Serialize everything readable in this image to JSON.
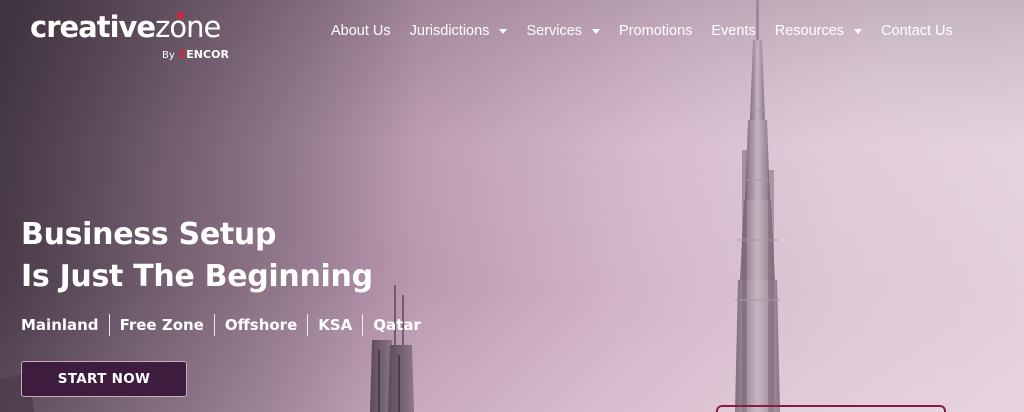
{
  "logo": {
    "name_bold": "creative",
    "name_light": "zone",
    "by": "By",
    "mark": "E",
    "company": "ENCOR",
    "accent_color": "#d4233f"
  },
  "nav": {
    "items": [
      {
        "label": "About Us",
        "has_dropdown": false
      },
      {
        "label": "Jurisdictions",
        "has_dropdown": true
      },
      {
        "label": "Services",
        "has_dropdown": true
      },
      {
        "label": "Promotions",
        "has_dropdown": false
      },
      {
        "label": "Events",
        "has_dropdown": false
      },
      {
        "label": "Resources",
        "has_dropdown": true
      },
      {
        "label": "Contact Us",
        "has_dropdown": false
      }
    ]
  },
  "hero": {
    "headline_line1": "Business Setup",
    "headline_line2": "Is Just The Beginning",
    "tags": [
      "Mainland",
      "Free Zone",
      "Offshore",
      "KSA",
      "Qatar"
    ],
    "cta_label": "START NOW",
    "cta_color": "#3d1c3e",
    "background_image": "dubai-skyline-burj-khalifa"
  }
}
